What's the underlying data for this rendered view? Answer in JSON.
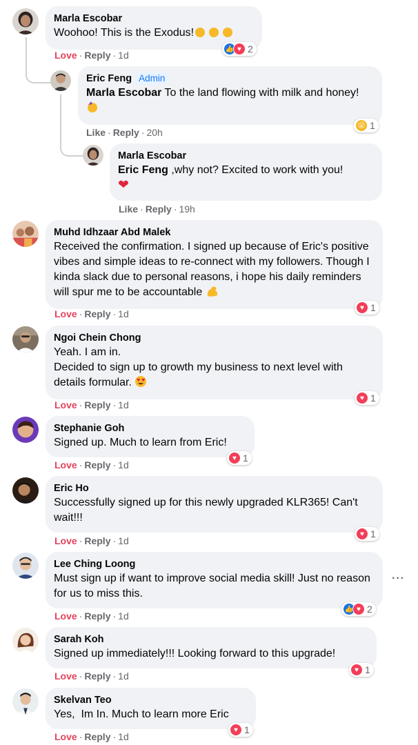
{
  "comments": [
    {
      "name": "Marla Escobar",
      "text": "Woohoo! This is the Exodus!",
      "action": "Love",
      "reply": "Reply",
      "time": "1d",
      "react_count": "2"
    },
    {
      "name": "Eric Feng",
      "badge": "Admin",
      "mention": "Marla Escobar",
      "text": " To the land flowing with milk and honey! ",
      "action": "Like",
      "reply": "Reply",
      "time": "20h",
      "react_count": "1"
    },
    {
      "name": "Marla Escobar",
      "mention": "Eric Feng",
      "text": " ,why not? Excited to work with you!",
      "action": "Like",
      "reply": "Reply",
      "time": "19h"
    },
    {
      "name": "Muhd Idhzaar Abd Malek",
      "text": "Received the confirmation. I signed up because of Eric's positive vibes and simple ideas to re-connect with my followers. Though I kinda slack due to personal reasons, i hope his daily reminders will spur me to be accountable ",
      "action": "Love",
      "reply": "Reply",
      "time": "1d",
      "react_count": "1"
    },
    {
      "name": "Ngoi Chein Chong",
      "line1": "Yeah. I am in.",
      "line2": "Decided to sign up to growth my business to next level with details formular. ",
      "action": "Love",
      "reply": "Reply",
      "time": "1d",
      "react_count": "1"
    },
    {
      "name": "Stephanie Goh",
      "text": "Signed up. Much to learn from Eric!",
      "action": "Love",
      "reply": "Reply",
      "time": "1d",
      "react_count": "1"
    },
    {
      "name": "Eric Ho",
      "text": "Successfully signed up for this newly upgraded KLR365! Can't wait!!!",
      "action": "Love",
      "reply": "Reply",
      "time": "1d",
      "react_count": "1"
    },
    {
      "name": "Lee Ching Loong",
      "text": "Must sign up if want to improve social media skill! Just no reason for us to miss this.",
      "action": "Love",
      "reply": "Reply",
      "time": "1d",
      "react_count": "2"
    },
    {
      "name": "Sarah Koh",
      "text": "Signed up immediately!!! Looking forward to this upgrade!",
      "action": "Love",
      "reply": "Reply",
      "time": "1d",
      "react_count": "1"
    },
    {
      "name": "Skelvan Teo",
      "text": "Yes,  Im In. Much to learn more Eric",
      "action": "Love",
      "reply": "Reply",
      "time": "1d",
      "react_count": "1"
    }
  ],
  "more_options_icon": "more-horizontal-icon",
  "colors": {
    "love": "#e2435b",
    "like_blue": "#1b74e4",
    "bubble": "#f0f2f5",
    "meta": "#65676b"
  }
}
